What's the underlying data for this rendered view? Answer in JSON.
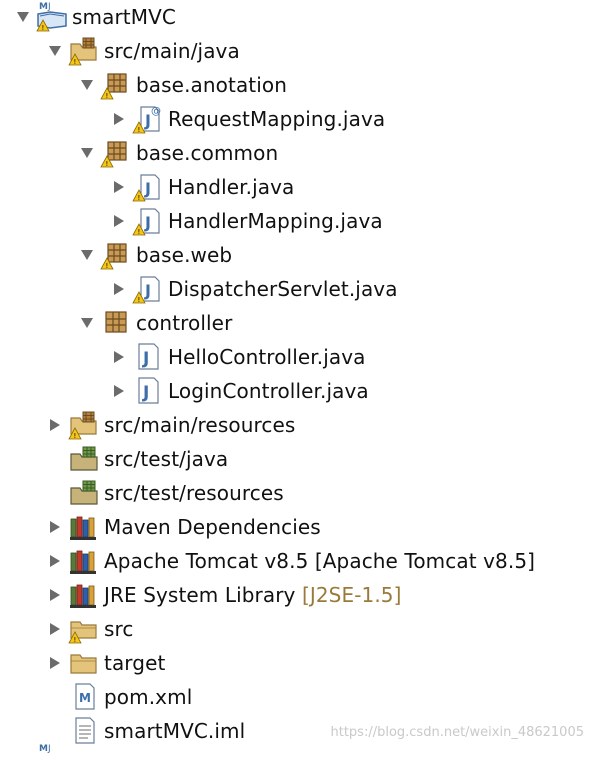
{
  "tree": {
    "root": {
      "label": "smartMVC",
      "icon": "maven-project-icon"
    },
    "src_main_java": {
      "label": "src/main/java",
      "icon": "source-folder-warning-icon"
    },
    "pkg_anotation": {
      "label": "base.anotation",
      "icon": "package-warning-icon"
    },
    "requestmapping": {
      "label": "RequestMapping.java",
      "icon": "java-annotation-file-warning-icon"
    },
    "pkg_common": {
      "label": "base.common",
      "icon": "package-warning-icon"
    },
    "handler": {
      "label": "Handler.java",
      "icon": "java-file-warning-icon"
    },
    "handlermapping": {
      "label": "HandlerMapping.java",
      "icon": "java-file-warning-icon"
    },
    "pkg_web": {
      "label": "base.web",
      "icon": "package-warning-icon"
    },
    "dispatcher": {
      "label": "DispatcherServlet.java",
      "icon": "java-file-warning-icon"
    },
    "pkg_controller": {
      "label": "controller",
      "icon": "package-icon"
    },
    "hello": {
      "label": "HelloController.java",
      "icon": "java-file-icon"
    },
    "login": {
      "label": "LoginController.java",
      "icon": "java-file-icon"
    },
    "src_main_resources": {
      "label": "src/main/resources",
      "icon": "source-folder-warning-icon"
    },
    "src_test_java": {
      "label": "src/test/java",
      "icon": "source-folder-icon"
    },
    "src_test_resources": {
      "label": "src/test/resources",
      "icon": "source-folder-icon"
    },
    "maven_deps": {
      "label": "Maven Dependencies",
      "icon": "library-icon"
    },
    "tomcat": {
      "label": "Apache Tomcat v8.5 [Apache Tomcat v8.5]",
      "icon": "library-icon"
    },
    "jre": {
      "label": "JRE System Library",
      "decoration": "[J2SE-1.5]",
      "icon": "library-icon"
    },
    "src": {
      "label": "src",
      "icon": "folder-warning-icon"
    },
    "target": {
      "label": "target",
      "icon": "folder-icon"
    },
    "pom": {
      "label": "pom.xml",
      "icon": "maven-pom-icon"
    },
    "iml": {
      "label": "smartMVC.iml",
      "icon": "text-file-icon"
    }
  },
  "watermark": "https://blog.csdn.net/weixin_48621005",
  "colors": {
    "twisty": "#6b6b6b",
    "folder": "#e3c47a",
    "package": "#b5803f",
    "java_j": "#3d6ea8",
    "warning": "#f5c518",
    "decoration": "#9a7a3a"
  }
}
